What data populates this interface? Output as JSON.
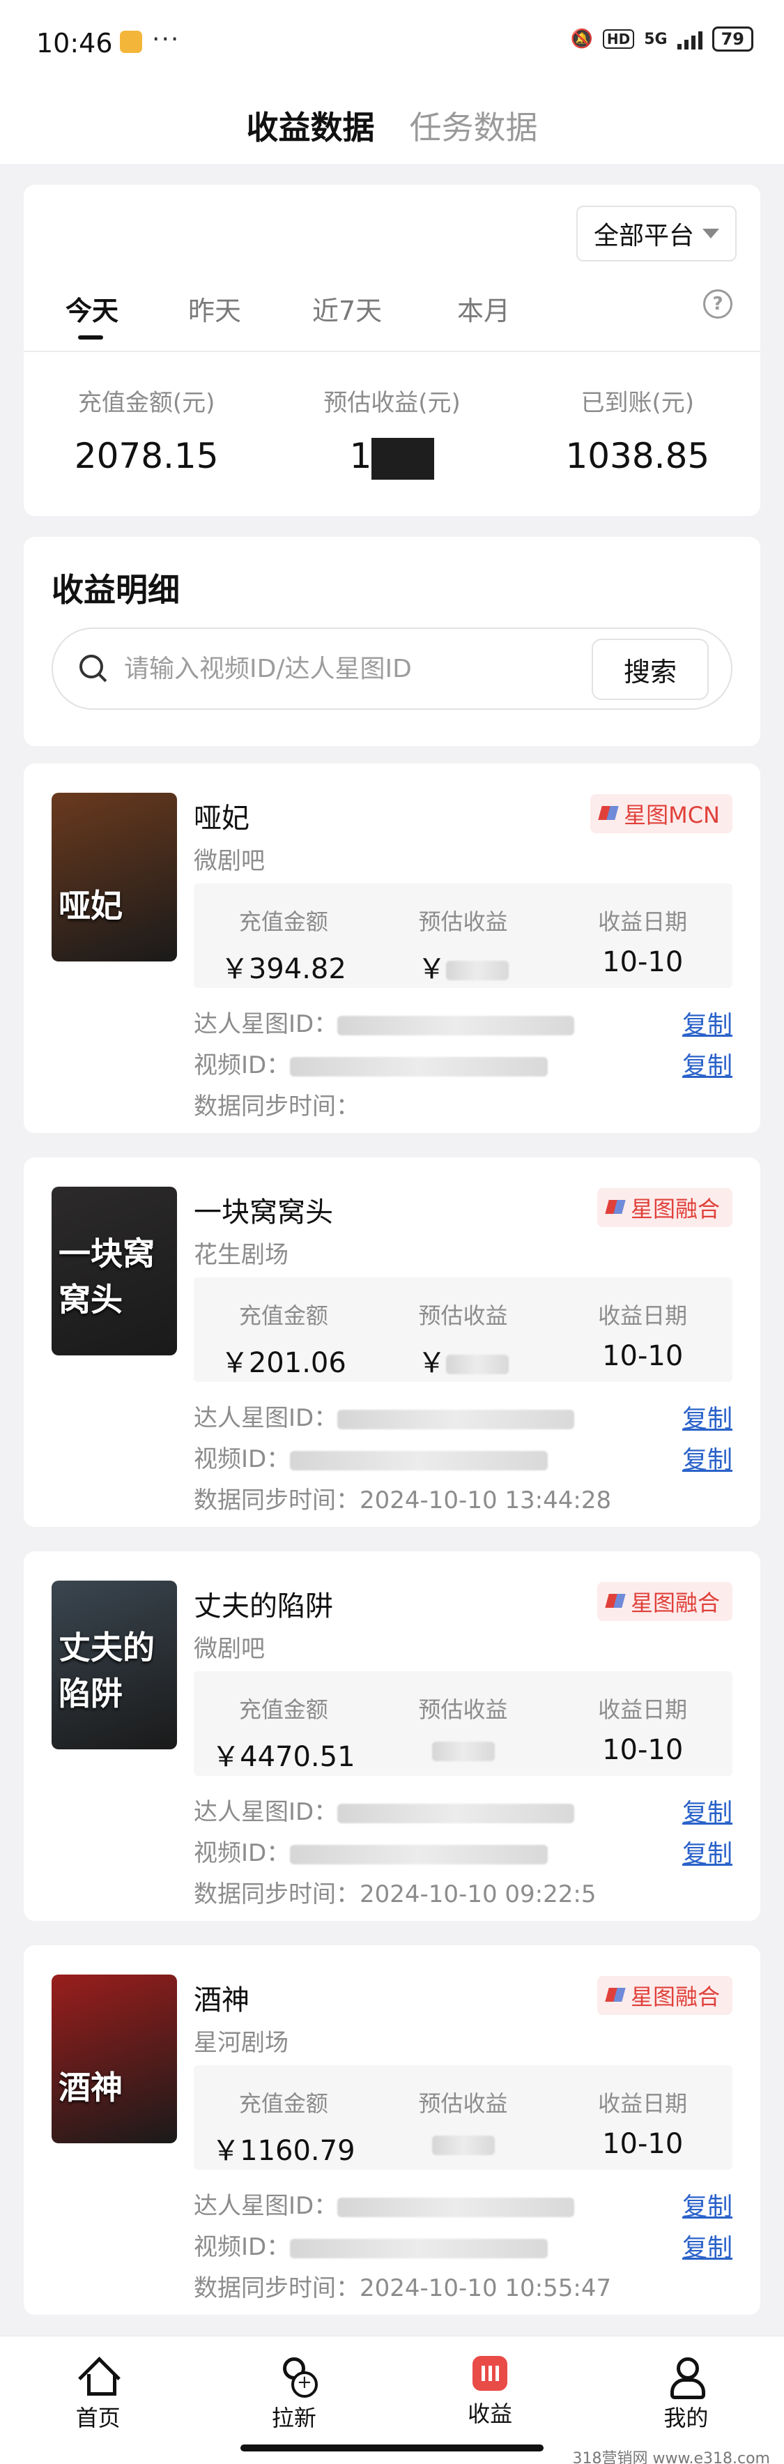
{
  "status_bar": {
    "time": "10:46",
    "more": "···",
    "net": "HD",
    "gen": "5G",
    "battery": "79"
  },
  "top_tabs": [
    {
      "label": "收益数据"
    },
    {
      "label": "任务数据"
    }
  ],
  "summary": {
    "platform": "全部平台",
    "periods": [
      {
        "label": "今天"
      },
      {
        "label": "昨天"
      },
      {
        "label": "近7天"
      },
      {
        "label": "本月"
      }
    ],
    "help": "?",
    "metrics": [
      {
        "label": "充值金额(元)",
        "value": "2078.15"
      },
      {
        "label": "预估收益(元)",
        "value": "1"
      },
      {
        "label": "已到账(元)",
        "value": "1038.85"
      }
    ]
  },
  "detail": {
    "title": "收益明细",
    "search_placeholder": "请输入视频ID/达人星图ID",
    "search_button": "搜索"
  },
  "labels": {
    "recharge": "充值金额",
    "estimate": "预估收益",
    "date": "收益日期",
    "talent_id": "达人星图ID：",
    "video_id": "视频ID：",
    "sync_time": "数据同步时间：",
    "copy": "复制"
  },
  "items": [
    {
      "title": "哑妃",
      "platform": "微剧吧",
      "badge": "星图MCN",
      "poster_text": "哑妃",
      "poster_color": "#6a3a1e",
      "recharge": "￥394.82",
      "estimate": "￥",
      "date": "10-10",
      "sync_time": ""
    },
    {
      "title": "一块窝窝头",
      "platform": "花生剧场",
      "badge": "星图融合",
      "poster_text": "一块窝窝头",
      "poster_color": "#2c2a2a",
      "recharge": "￥201.06",
      "estimate": "￥",
      "date": "10-10",
      "sync_time": "2024-10-10 13:44:28"
    },
    {
      "title": "丈夫的陷阱",
      "platform": "微剧吧",
      "badge": "星图融合",
      "poster_text": "丈夫的陷阱",
      "poster_color": "#3a4650",
      "recharge": "￥4470.51",
      "estimate": "",
      "date": "10-10",
      "sync_time": "2024-10-10 09:22:5"
    },
    {
      "title": "酒神",
      "platform": "星河剧场",
      "badge": "星图融合",
      "poster_text": "酒神",
      "poster_color": "#9a1e1c",
      "recharge": "￥1160.79",
      "estimate": "",
      "date": "10-10",
      "sync_time": "2024-10-10 10:55:47"
    }
  ],
  "tabbar": [
    {
      "label": "首页"
    },
    {
      "label": "拉新"
    },
    {
      "label": "收益"
    },
    {
      "label": "我的"
    }
  ],
  "watermark": "318营销网 www.e318.com"
}
